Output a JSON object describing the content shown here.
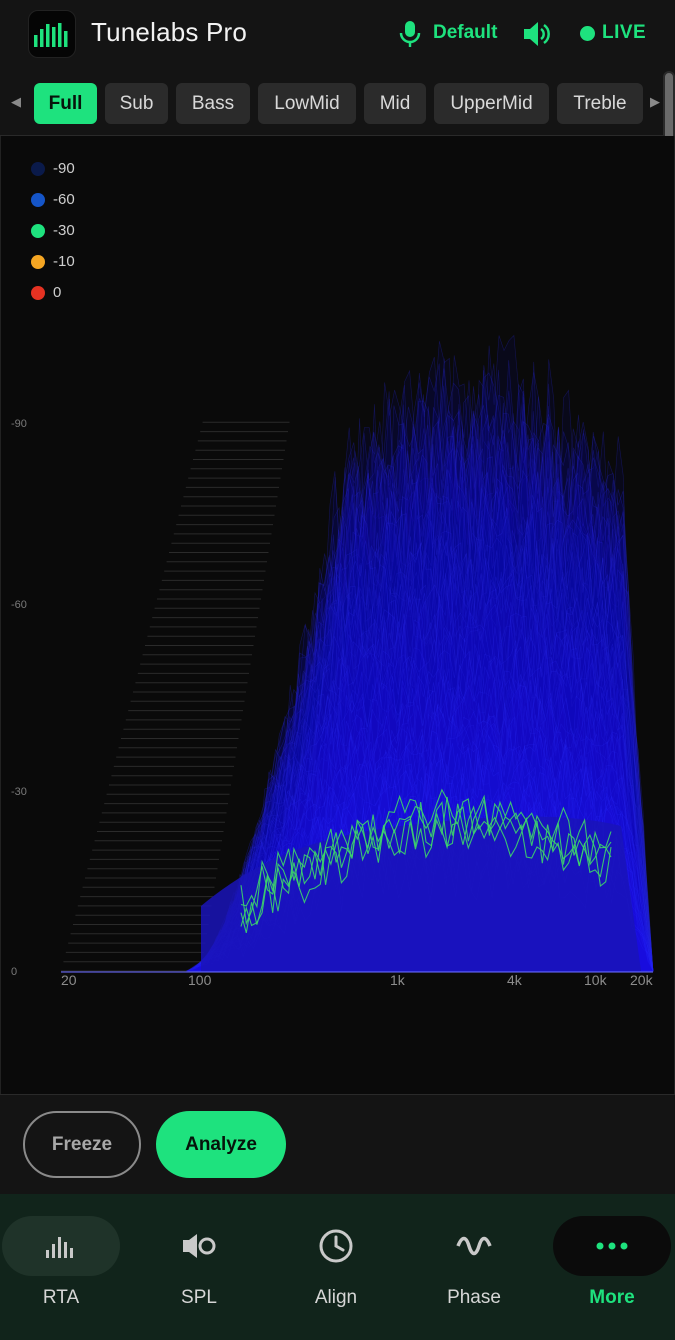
{
  "header": {
    "app_title": "Tunelabs Pro",
    "app_icon": "bar-chart-icon",
    "mic_icon": "microphone-icon",
    "input_label": "Default",
    "speaker_icon": "speaker-icon",
    "status_label": "LIVE",
    "accent_color": "#1ee27e"
  },
  "tabs": {
    "items": [
      {
        "label": "Full",
        "active": true
      },
      {
        "label": "Sub",
        "active": false
      },
      {
        "label": "Bass",
        "active": false
      },
      {
        "label": "LowMid",
        "active": false
      },
      {
        "label": "Mid",
        "active": false
      },
      {
        "label": "UpperMid",
        "active": false
      },
      {
        "label": "Treble",
        "active": false
      }
    ],
    "prev_arrow": "◀",
    "next_arrow": "▶"
  },
  "legend": {
    "items": [
      {
        "label": "-90",
        "color": "#0a1a4a"
      },
      {
        "label": "-60",
        "color": "#1555c8"
      },
      {
        "label": "-30",
        "color": "#1ee27e"
      },
      {
        "label": "-10",
        "color": "#f5a623"
      },
      {
        "label": "0",
        "color": "#e53222"
      }
    ]
  },
  "plot": {
    "y_ticks": [
      "-90",
      "-60",
      "-30",
      "0"
    ],
    "x_ticks": [
      "20",
      "100",
      "1k",
      "4k",
      "10k",
      "20k"
    ]
  },
  "controls": {
    "freeze_label": "Freeze",
    "analyze_label": "Analyze"
  },
  "nav": {
    "items": [
      {
        "label": "RTA",
        "icon": "rta-bars-icon",
        "active": false
      },
      {
        "label": "SPL",
        "icon": "spl-meter-icon",
        "active": false
      },
      {
        "label": "Align",
        "icon": "clock-icon",
        "active": false
      },
      {
        "label": "Phase",
        "icon": "wave-icon",
        "active": false
      },
      {
        "label": "More",
        "icon": "more-dots-icon",
        "active": true
      }
    ]
  }
}
